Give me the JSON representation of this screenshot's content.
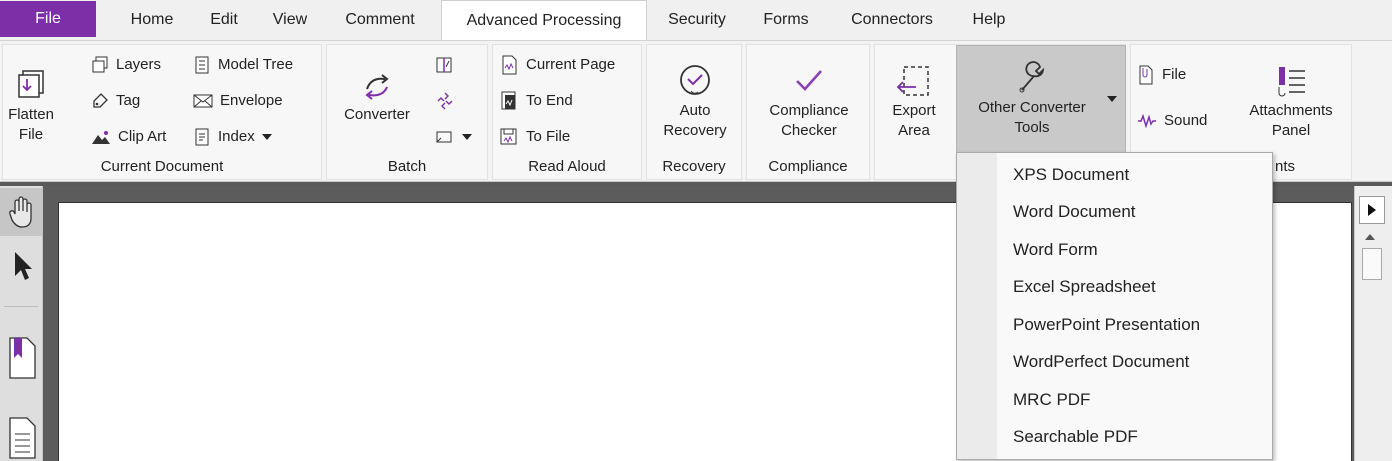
{
  "tabs": [
    {
      "label": "File"
    },
    {
      "label": "Home"
    },
    {
      "label": "Edit"
    },
    {
      "label": "View"
    },
    {
      "label": "Comment"
    },
    {
      "label": "Advanced Processing"
    },
    {
      "label": "Security"
    },
    {
      "label": "Forms"
    },
    {
      "label": "Connectors"
    },
    {
      "label": "Help"
    }
  ],
  "groups": {
    "current_document": {
      "label": "Current Document",
      "flatten": "Flatten\nFile",
      "layers": "Layers",
      "tag": "Tag",
      "clip_art": "Clip Art",
      "model_tree": "Model Tree",
      "envelope": "Envelope",
      "index": "Index"
    },
    "batch": {
      "label": "Batch",
      "converter": "Converter"
    },
    "read_aloud": {
      "label": "Read Aloud",
      "current_page": "Current Page",
      "to_end": "To End",
      "to_file": "To File"
    },
    "recovery": {
      "label": "Recovery",
      "auto_recovery": "Auto\nRecovery"
    },
    "compliance": {
      "label": "Compliance",
      "checker": "Compliance\nChecker"
    },
    "export": {
      "export_area": "Export\nArea",
      "other_converter_tools": "Other Converter\nTools"
    },
    "attachments": {
      "label_fragment": "nts",
      "file": "File",
      "sound": "Sound",
      "panel": "Attachments\nPanel"
    }
  },
  "dropdown": {
    "items": [
      "XPS Document",
      "Word Document",
      "Word Form",
      "Excel Spreadsheet",
      "PowerPoint Presentation",
      "WordPerfect Document",
      "MRC PDF",
      "Searchable PDF"
    ]
  },
  "colors": {
    "file_tab": "#7d2fa8",
    "accent": "#8a3fb5",
    "doc_bg": "#5c5c5c"
  }
}
